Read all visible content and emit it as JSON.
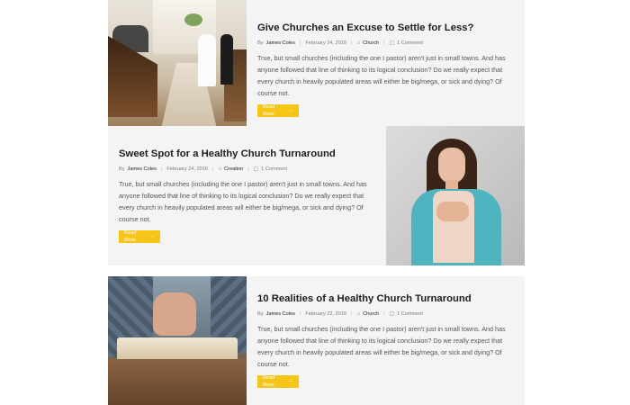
{
  "posts": [
    {
      "title": "Give Churches an Excuse to Settle for Less?",
      "author_prefix": "By",
      "author": "James Coles",
      "date": "February 24, 2016",
      "category": "Church",
      "comments": "1 Comment",
      "excerpt": "True, but small churches (including the one I pastor) aren't just in small towns. And has anyone followed that line of thinking to its logical conclusion? Do we really expect that every church in heavily populated areas will either be big/mega, or sick and dying? Of course not.",
      "read_more": "Read More",
      "image": "wedding-church-image"
    },
    {
      "title": "Sweet Spot for a Healthy Church Turnaround",
      "author_prefix": "By",
      "author": "James Coles",
      "date": "February 24, 2016",
      "category": "Creation",
      "comments": "1 Comment",
      "excerpt": "True, but small churches (including the one I pastor) aren't just in small towns. And has anyone followed that line of thinking to its logical conclusion? Do we really expect that every church in heavily populated areas will either be big/mega, or sick and dying? Of course not.",
      "read_more": "Read More",
      "image": "praying-woman-image"
    },
    {
      "title": "10 Realities of a Healthy Church Turnaround",
      "author_prefix": "By",
      "author": "James Coles",
      "date": "February 22, 2016",
      "category": "Church",
      "comments": "1 Comment",
      "excerpt": "True, but small churches (including the one I pastor) aren't just in small towns. And has anyone followed that line of thinking to its logical conclusion? Do we really expect that every church in heavily populated areas will either be big/mega, or sick and dying? Of course not.",
      "read_more": "Read More",
      "image": "praying-hands-book-image"
    }
  ],
  "icons": {
    "category": "tag-icon",
    "comments": "comment-icon",
    "read_more": "arrow-right-icon"
  },
  "colors": {
    "accent": "#f5c518",
    "card_bg": "#f4f4f4",
    "title": "#1d1d1d"
  }
}
